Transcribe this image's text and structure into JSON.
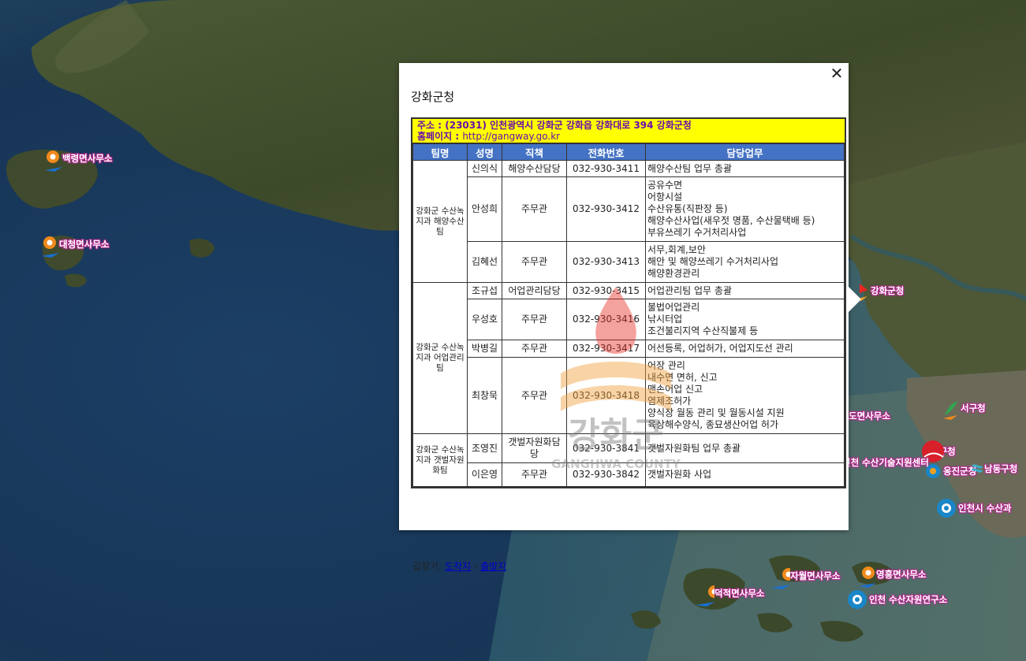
{
  "colors": {
    "sea": "#1d4d68",
    "land": "#3d4a2a",
    "label_outline": "#b02a8c",
    "address_bg": "#ffff00",
    "address_text": "#6a0dad",
    "header_bg": "#4472c4"
  },
  "map_markers": [
    {
      "name": "백령면사무소",
      "icon": "orange-circle-marker"
    },
    {
      "name": "대청면사무소",
      "icon": "orange-circle-marker"
    },
    {
      "name": "강화군청",
      "icon": "red-flag-marker"
    },
    {
      "name": "북도면사무소",
      "icon": "orange-circle-marker"
    },
    {
      "name": "서구청",
      "icon": "orange-green-marker"
    },
    {
      "name": "중구청",
      "icon": "red-circle-marker"
    },
    {
      "name": "인천 수산기술지원센터",
      "icon": "blue-circle-marker"
    },
    {
      "name": "옹진군청",
      "icon": "blue-circle-marker"
    },
    {
      "name": "남동구청",
      "icon": "teal-wave-marker"
    },
    {
      "name": "인천시 수산과",
      "icon": "blue-circle-marker"
    },
    {
      "name": "영흥면사무소",
      "icon": "orange-circle-marker"
    },
    {
      "name": "자월면사무소",
      "icon": "orange-circle-marker"
    },
    {
      "name": "덕적면사무소",
      "icon": "orange-circle-marker"
    },
    {
      "name": "인천 수산자원연구소",
      "icon": "blue-circle-marker"
    }
  ],
  "popup": {
    "title": "강화군청",
    "close_icon": "close-icon",
    "address_label": "주소 : ",
    "address": "(23031) 인천광역시 강화군 강화읍 강화대로 394 강화군청",
    "homepage_label": "홈페이지 : ",
    "homepage": "http://gangway.go.kr",
    "columns": [
      "팀명",
      "성명",
      "직책",
      "전화번호",
      "담당업무"
    ],
    "teams": [
      {
        "team": "강화군 수산녹지과 해양수산팀",
        "rows": [
          {
            "name": "신의식",
            "position": "해양수산담당",
            "phone": "032-930-3411",
            "duties": [
              "해양수산팀 업무 총괄"
            ]
          },
          {
            "name": "안성희",
            "position": "주무관",
            "phone": "032-930-3412",
            "duties": [
              "공유수면",
              "어항시설",
              "수산유통(직판장 등)",
              "해양수산사업(새우젓 명품, 수산물택배 등)",
              "부유쓰레기 수거처리사업"
            ]
          },
          {
            "name": "김혜선",
            "position": "주무관",
            "phone": "032-930-3413",
            "duties": [
              "서무,회계,보안",
              "해안 및 해양쓰레기 수거처리사업",
              "해양환경관리"
            ]
          }
        ]
      },
      {
        "team": "강화군 수산녹지과 어업관리팀",
        "rows": [
          {
            "name": "조규섭",
            "position": "어업관리담당",
            "phone": "032-930-3415",
            "duties": [
              "어업관리팀 업무 총괄"
            ]
          },
          {
            "name": "우성호",
            "position": "주무관",
            "phone": "032-930-3416",
            "duties": [
              "불법어업관리",
              "낚시터업",
              "조건불리지역 수산직불제 등"
            ]
          },
          {
            "name": "박병길",
            "position": "주무관",
            "phone": "032-930-3417",
            "duties": [
              "어선등록, 어업허가, 어업지도선 관리"
            ]
          },
          {
            "name": "최창묵",
            "position": "주무관",
            "phone": "032-930-3418",
            "duties": [
              "어장 관리",
              "내수면 면허, 신고",
              "맨손어업 신고",
              "염제조허가",
              "양식장 월동 관리 및 월동시설 지원",
              "육상해수양식, 종묘생산어업 허가"
            ]
          }
        ]
      },
      {
        "team": "강화군 수산녹지과 갯벌자원화팀",
        "rows": [
          {
            "name": "조영진",
            "position": "갯벌자원화담당",
            "phone": "032-930-3841",
            "duties": [
              "갯벌자원화팀 업무 총괄"
            ]
          },
          {
            "name": "이은영",
            "position": "주무관",
            "phone": "032-930-3842",
            "duties": [
              "갯벌자원화 사업"
            ]
          }
        ]
      }
    ],
    "watermark": {
      "korean": "강화군",
      "english": "GANGHWA COUNTY"
    },
    "route_label": "길찾기: ",
    "route_dest": "도착지",
    "route_sep": " - ",
    "route_origin": "출발지"
  }
}
